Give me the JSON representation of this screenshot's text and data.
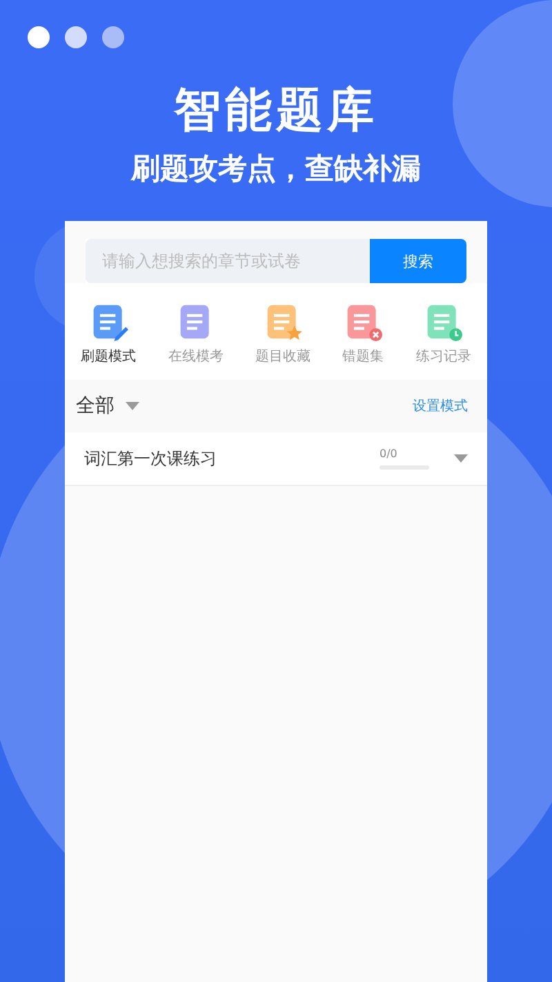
{
  "dots": [
    {
      "color": "#ffffff"
    },
    {
      "color": "#d3dcfb"
    },
    {
      "color": "#a9bcf8"
    }
  ],
  "title": "智能题库",
  "subtitle": "刷题攻考点，查缺补漏",
  "search": {
    "placeholder": "请输入想搜索的章节或试卷",
    "button": "搜索"
  },
  "tabs": [
    {
      "label": "刷题模式",
      "selected": true,
      "color": "#5b9bf8",
      "kind": "pen"
    },
    {
      "label": "在线模考",
      "selected": false,
      "color": "#a5a8f7",
      "kind": "plain"
    },
    {
      "label": "题目收藏",
      "selected": false,
      "color": "#fcc27a",
      "kind": "star"
    },
    {
      "label": "错题集",
      "selected": false,
      "color": "#f9979a",
      "kind": "cross"
    },
    {
      "label": "练习记录",
      "selected": false,
      "color": "#7fe2b9",
      "kind": "clock"
    }
  ],
  "filter": {
    "label": "全部",
    "action": "设置模式"
  },
  "rows": [
    {
      "title": "词汇第一次课练习",
      "count": "0/0",
      "level": 0
    }
  ]
}
